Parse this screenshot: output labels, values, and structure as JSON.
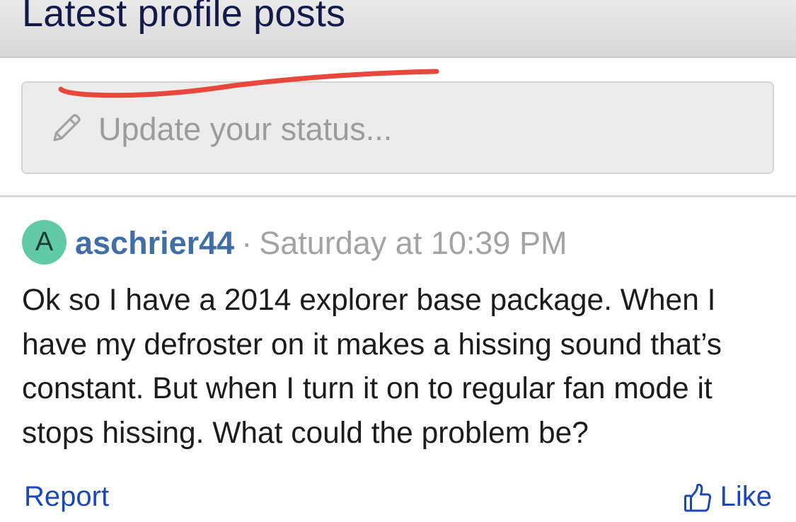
{
  "section": {
    "title": "Latest profile posts"
  },
  "status_input": {
    "placeholder": "Update your status...",
    "icon": "pencil-icon"
  },
  "annotation": {
    "color": "#e8483b"
  },
  "post": {
    "avatar_letter": "A",
    "avatar_color": "#62c9a6",
    "username": "aschrier44",
    "separator": "·",
    "timestamp": "Saturday at 10:39 PM",
    "body_lines": [
      "Ok so I have a 2014 explorer base package. When I",
      "have my defroster on it makes a hissing sound that’s",
      "constant. But when I turn it on to regular fan mode it",
      "stops hissing. What could the problem be?"
    ],
    "actions": {
      "report_label": "Report",
      "like_label": "Like",
      "like_icon": "thumbs-up-icon"
    }
  },
  "colors": {
    "link": "#1b48b8",
    "username": "#3f6ea9",
    "title": "#141a4a"
  }
}
